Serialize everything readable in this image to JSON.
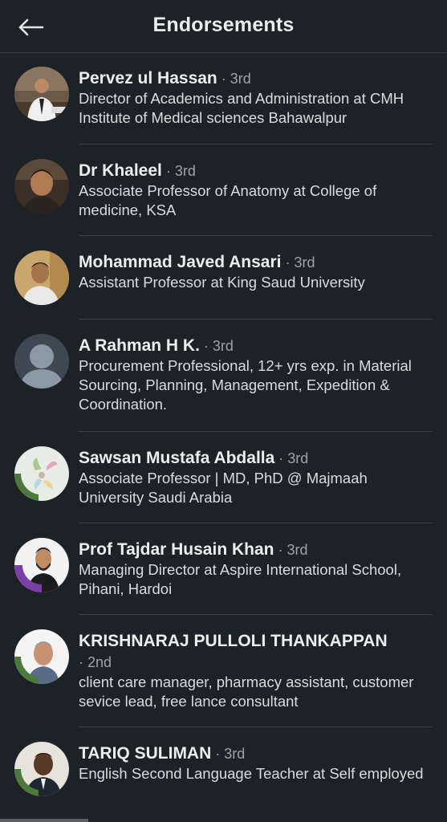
{
  "header": {
    "title": "Endorsements",
    "back_icon": "arrow-left-icon"
  },
  "endorsers": [
    {
      "name": "Pervez ul Hassan",
      "degree": " · 3rd",
      "headline": "Director of Academics and Administration  at CMH Institute of Medical sciences Bahawalpur",
      "avatar_bg": "#6b5a48"
    },
    {
      "name": "Dr Khaleel",
      "degree": " · 3rd",
      "headline": "Associate Professor of Anatomy at College of medicine, KSA",
      "avatar_bg": "#3a3028"
    },
    {
      "name": "Mohammad Javed Ansari",
      "degree": " · 3rd",
      "headline": "Assistant Professor at King Saud University",
      "avatar_bg": "#c9a66b"
    },
    {
      "name": "A Rahman H K.",
      "degree": " · 3rd",
      "headline": "Procurement Professional, 12+ yrs exp. in Material Sourcing, Planning, Management, Expedition & Coordination.",
      "avatar_bg": "#3d4852"
    },
    {
      "name": "Sawsan Mustafa Abdalla",
      "degree": " · 3rd",
      "headline": "Associate Professor | MD, PhD @ Majmaah University Saudi Arabia",
      "avatar_bg": "#e8ece6",
      "badge": "#OPENTOWORK"
    },
    {
      "name": "Prof Tajdar Husain Khan",
      "degree": " · 3rd",
      "headline": "Managing Director at Aspire International School, Pihani, Hardoi",
      "avatar_bg": "#f2f2f2",
      "badge": "#HIRING"
    },
    {
      "name": "KRISHNARAJ PULLOLI THANKAPPAN",
      "degree": " · 2nd",
      "headline": "client care manager, pharmacy assistant, customer sevice lead, free lance consultant",
      "avatar_bg": "#f4f4f4",
      "badge": "#OPENTOWORK"
    },
    {
      "name": "TARIQ SULIMAN",
      "degree": " · 3rd",
      "headline": "English Second Language Teacher at Self employed",
      "avatar_bg": "#e6e2dc",
      "badge": "#OPENTOWORK"
    }
  ]
}
